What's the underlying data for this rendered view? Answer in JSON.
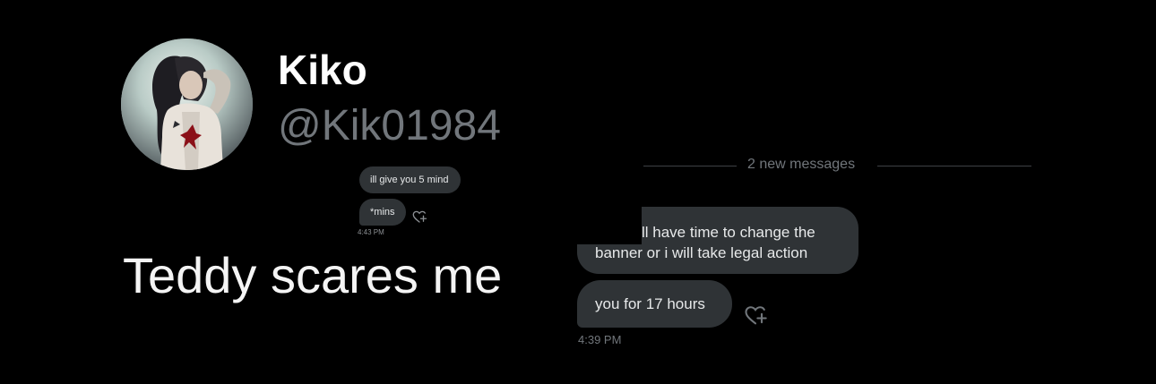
{
  "profile": {
    "display_name": "Kiko",
    "handle": "@Kik01984"
  },
  "tweet": {
    "text": "Teddy scares me"
  },
  "small_dm": {
    "messages": [
      "ill give you 5 mind",
      "*mins"
    ],
    "timestamp": "4:43 PM",
    "reaction_icon": "heart-plus-icon"
  },
  "dm": {
    "divider_text": "2 new messages",
    "message_1_line_1": "ll have time to change the",
    "message_1_line_2": "banner or i will take legal action",
    "message_2": "you for 17 hours",
    "timestamp": "4:39 PM",
    "reaction_icon": "heart-plus-icon"
  },
  "colors": {
    "background": "#000000",
    "bubble": "#2f3336",
    "muted_text": "#71767b",
    "primary_text": "#e7e9ea"
  }
}
